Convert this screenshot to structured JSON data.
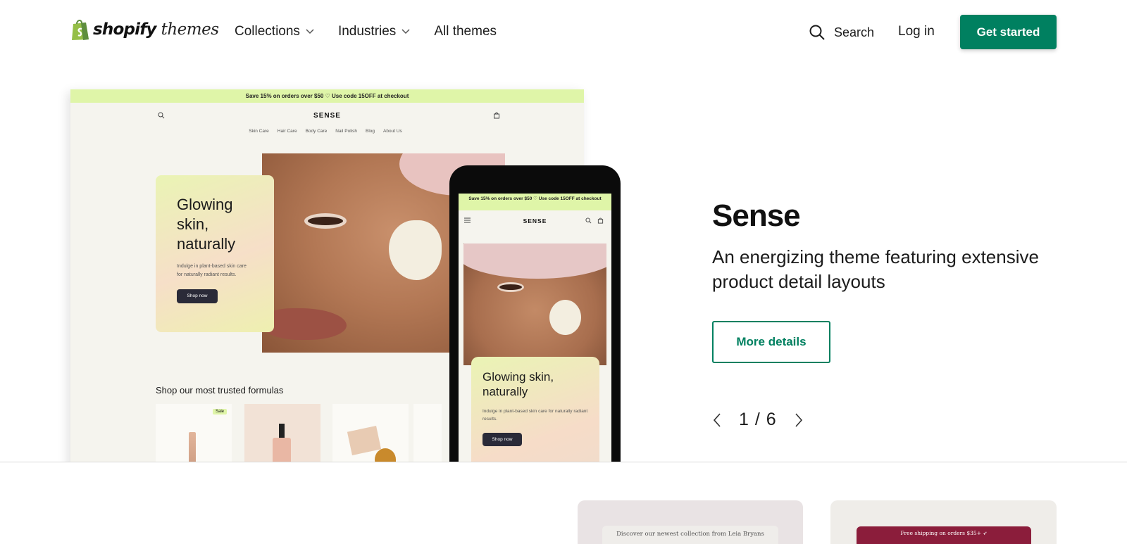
{
  "header": {
    "logo_word": "shopify",
    "logo_sub": "themes",
    "nav": [
      {
        "label": "Collections"
      },
      {
        "label": "Industries"
      },
      {
        "label": "All themes"
      }
    ],
    "search_label": "Search",
    "login_label": "Log in",
    "cta_label": "Get started"
  },
  "hero": {
    "theme_name": "Sense",
    "theme_description": "An energizing theme featuring extensive product detail layouts",
    "more_details_label": "More details",
    "pager_text": "1 / 6",
    "accent_color": "#008060"
  },
  "desktop_preview": {
    "banner": "Save 15% on orders over $50 ♡ Use code 15OFF at checkout",
    "brand": "SENSE",
    "menu": [
      "Skin Care",
      "Hair Care",
      "Body Care",
      "Nail Polish",
      "Blog",
      "About Us"
    ],
    "card_title": "Glowing skin, naturally",
    "card_text": "Indulge in plant-based skin care for naturally radiant results.",
    "card_button": "Shop now",
    "section_title": "Shop our most trusted formulas",
    "sale_badge": "Sale"
  },
  "phone_preview": {
    "banner": "Save 15% on orders over $50 ♡ Use code 15OFF at checkout",
    "brand": "SENSE",
    "card_title": "Glowing skin, naturally",
    "card_text": "Indulge in plant-based skin care for naturally radiant results.",
    "card_button": "Shop now"
  },
  "bottom_cards": [
    {
      "text": "Discover our newest collection from Leia Bryans"
    },
    {
      "text": "Free shipping on orders $35+ ➶"
    }
  ]
}
